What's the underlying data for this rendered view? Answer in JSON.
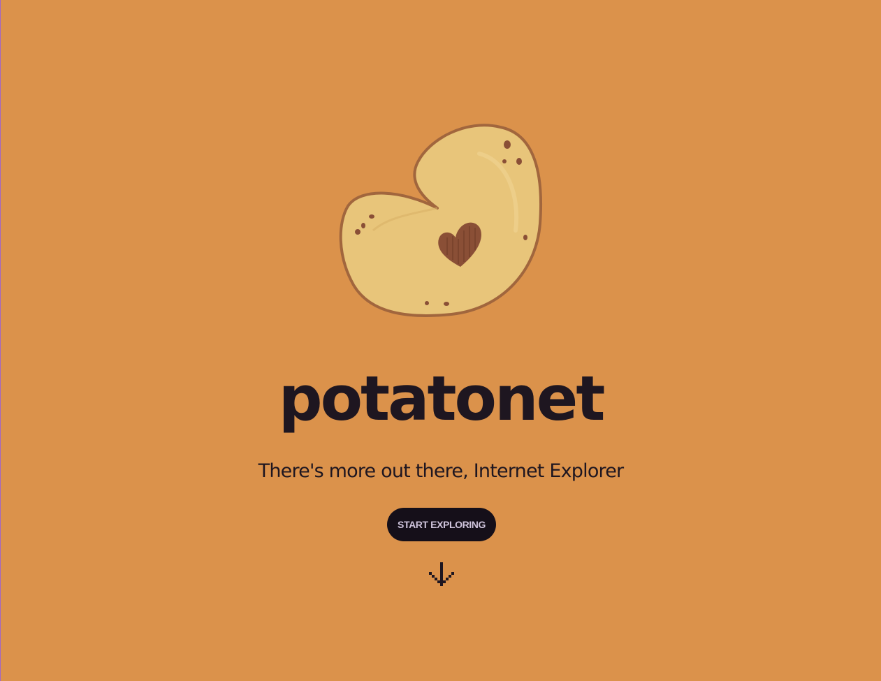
{
  "colors": {
    "background": "#db924b",
    "potato_fill": "#e8c57a",
    "potato_outline": "#a1663d",
    "text": "#1e1620",
    "button_bg": "#150f19",
    "button_text": "#cfc4dc"
  },
  "hero": {
    "logo_icon": "potato-heart-icon",
    "brand_name": "potatonet",
    "tagline": "There's more out there, Internet Explorer",
    "cta_label": "START EXPLORING",
    "scroll_icon": "pixel-arrow-down-icon"
  }
}
